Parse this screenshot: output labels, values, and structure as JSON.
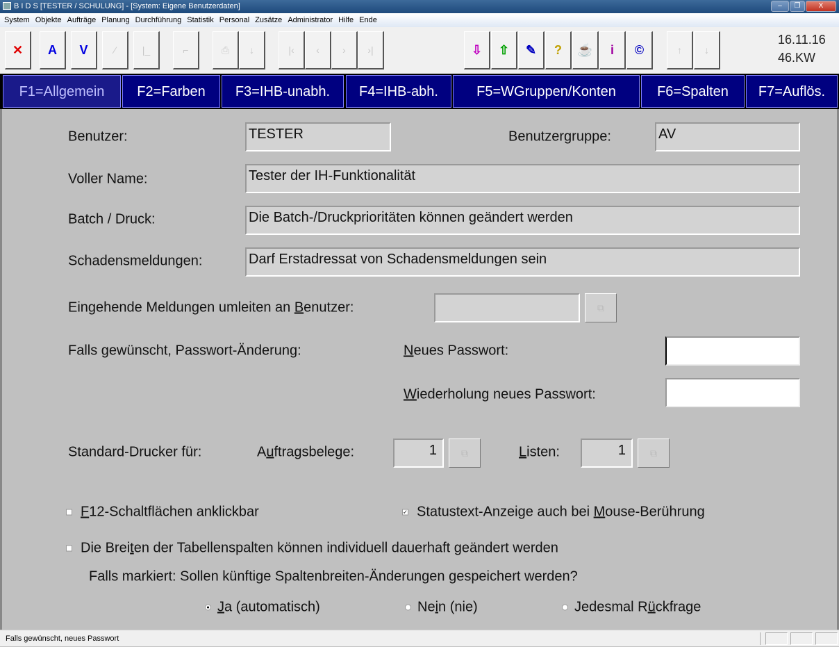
{
  "window": {
    "title": "B I D S  [TESTER / SCHULUNG] - [System: Eigene Benutzerdaten]",
    "minimize": "–",
    "restore": "❐",
    "close": "X"
  },
  "menu": [
    "System",
    "Objekte",
    "Aufträge",
    "Planung",
    "Durchführung",
    "Statistik",
    "Personal",
    "Zusätze",
    "Administrator",
    "Hilfe",
    "Ende"
  ],
  "toolbar": {
    "date": "16.11.16",
    "week": "46.KW",
    "buttons": [
      {
        "icon": "close-icon",
        "glyph": "✕",
        "color": "#e00000"
      },
      {
        "icon": "accept-icon",
        "glyph": "A",
        "color": "#0000e0"
      },
      {
        "icon": "v-icon",
        "glyph": "V",
        "color": "#0000e0"
      },
      {
        "icon": "edit-icon",
        "glyph": "⁄"
      },
      {
        "icon": "list-icon",
        "glyph": "|_"
      },
      {
        "icon": "copy-icon",
        "glyph": "⌐"
      },
      {
        "icon": "print-icon",
        "glyph": "⎙"
      },
      {
        "icon": "download-icon",
        "glyph": "↓"
      },
      {
        "icon": "first-icon",
        "glyph": "|‹"
      },
      {
        "icon": "prev-icon",
        "glyph": "‹"
      },
      {
        "icon": "next-icon",
        "glyph": "›"
      },
      {
        "icon": "last-icon",
        "glyph": "›|"
      },
      {
        "icon": "import-icon",
        "glyph": "⇩",
        "color": "#c000c0"
      },
      {
        "icon": "export-icon",
        "glyph": "⇧",
        "color": "#00a000"
      },
      {
        "icon": "pen-icon",
        "glyph": "✎",
        "color": "#0000c0"
      },
      {
        "icon": "help-icon",
        "glyph": "?",
        "color": "#c0a000"
      },
      {
        "icon": "coffee-icon",
        "glyph": "☕",
        "color": "#555"
      },
      {
        "icon": "info-icon",
        "glyph": "i",
        "color": "#a000a0"
      },
      {
        "icon": "copyright-icon",
        "glyph": "©",
        "color": "#0000c0"
      },
      {
        "icon": "up-icon",
        "glyph": "↑"
      },
      {
        "icon": "down-icon",
        "glyph": "↓"
      }
    ]
  },
  "tabs": [
    "F1=Allgemein",
    "F2=Farben",
    "F3=IHB-unabh.",
    "F4=IHB-abh.",
    "F5=WGruppen/Konten",
    "F6=Spalten",
    "F7=Auflös."
  ],
  "form": {
    "user_label": "Benutzer:",
    "user_value": "TESTER",
    "group_label": "Benutzergruppe:",
    "group_value": "AV",
    "fullname_label": "Voller Name:",
    "fullname_value": "Tester der IH-Funktionalität",
    "batch_label": "Batch / Druck:",
    "batch_value": "Die Batch-/Druckprioritäten können geändert werden",
    "damage_label": "Schadensmeldungen:",
    "damage_value": "Darf Erstadressat von Schadensmeldungen sein",
    "redirect_label": {
      "pre": "Eingehende Meldungen umleiten an ",
      "acc": "B",
      "post": "enutzer:"
    },
    "redirect_value": "",
    "pw_intro": "Falls gewünscht, Passwort-Änderung:",
    "pw_new": {
      "pre": "",
      "acc": "N",
      "post": "eues Passwort:"
    },
    "pw_repeat": {
      "pre": "",
      "acc": "W",
      "post": "iederholung neues Passwort:"
    },
    "printer_label": "Standard-Drucker für:",
    "orders_label": {
      "pre": "A",
      "acc": "u",
      "post": "ftragsbelege:"
    },
    "orders_value": "1",
    "lists_label": {
      "pre": "",
      "acc": "L",
      "post": "isten:"
    },
    "lists_value": "1",
    "cb_f12": {
      "pre": "",
      "acc": "F",
      "post": "12-Schaltflächen anklickbar",
      "checked": false
    },
    "cb_status": {
      "pre": "Statustext-Anzeige auch bei ",
      "acc": "M",
      "post": "ouse-Berührung",
      "checked": true
    },
    "cb_widths": {
      "pre": "Die Brei",
      "acc": "t",
      "post": "en der Tabellenspalten können individuell dauerhaft geändert werden",
      "checked": false
    },
    "question": "Falls markiert: Sollen künftige Spaltenbreiten-Änderungen gespeichert werden?",
    "radio_yes": {
      "pre": "",
      "acc": "J",
      "post": "a (automatisch)",
      "selected": true
    },
    "radio_no": {
      "pre": "Ne",
      "acc": "i",
      "post": "n (nie)",
      "selected": false
    },
    "radio_ask": {
      "pre": "Jedesmal R",
      "acc": "ü",
      "post": "ckfrage",
      "selected": false
    }
  },
  "status": {
    "text": "Falls gewünscht, neues Passwort"
  }
}
